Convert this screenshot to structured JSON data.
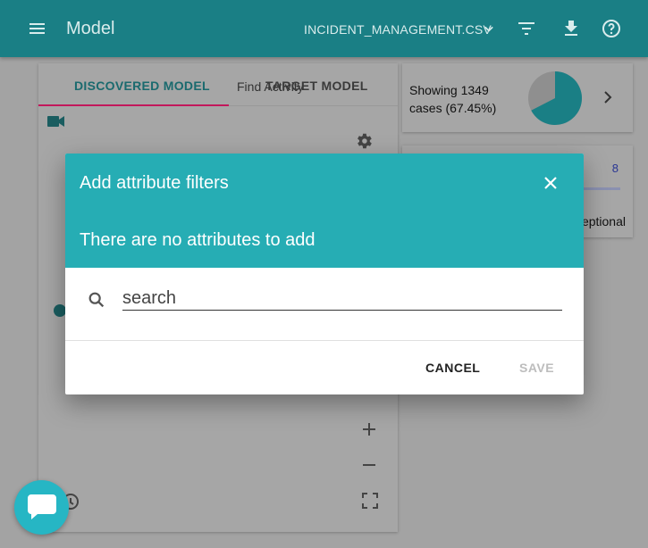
{
  "appbar": {
    "title": "Model",
    "file_name": "INCIDENT_MANAGEMENT.CSV",
    "icons": [
      "menu-icon",
      "chevron-down-icon",
      "filter-icon",
      "download-icon",
      "help-icon"
    ]
  },
  "tabs": {
    "discovered": "DISCOVERED MODEL",
    "target": "TARGET MODEL",
    "find_activity": "Find Activity"
  },
  "summary": {
    "cases_text": "Showing 1349 cases (67.45%)",
    "pie_fraction": 0.6745
  },
  "variants_card": {
    "count": "8",
    "label": "eptional"
  },
  "dialog": {
    "title": "Add attribute filters",
    "message": "There are no attributes to add",
    "search_placeholder": "search",
    "cancel_label": "CANCEL",
    "save_label": "SAVE"
  },
  "colors": {
    "appbar": "#1a7f85",
    "dialog_header": "#26adb4",
    "tab_underline": "#c2185b",
    "chat_bubble": "#26b6c4"
  }
}
